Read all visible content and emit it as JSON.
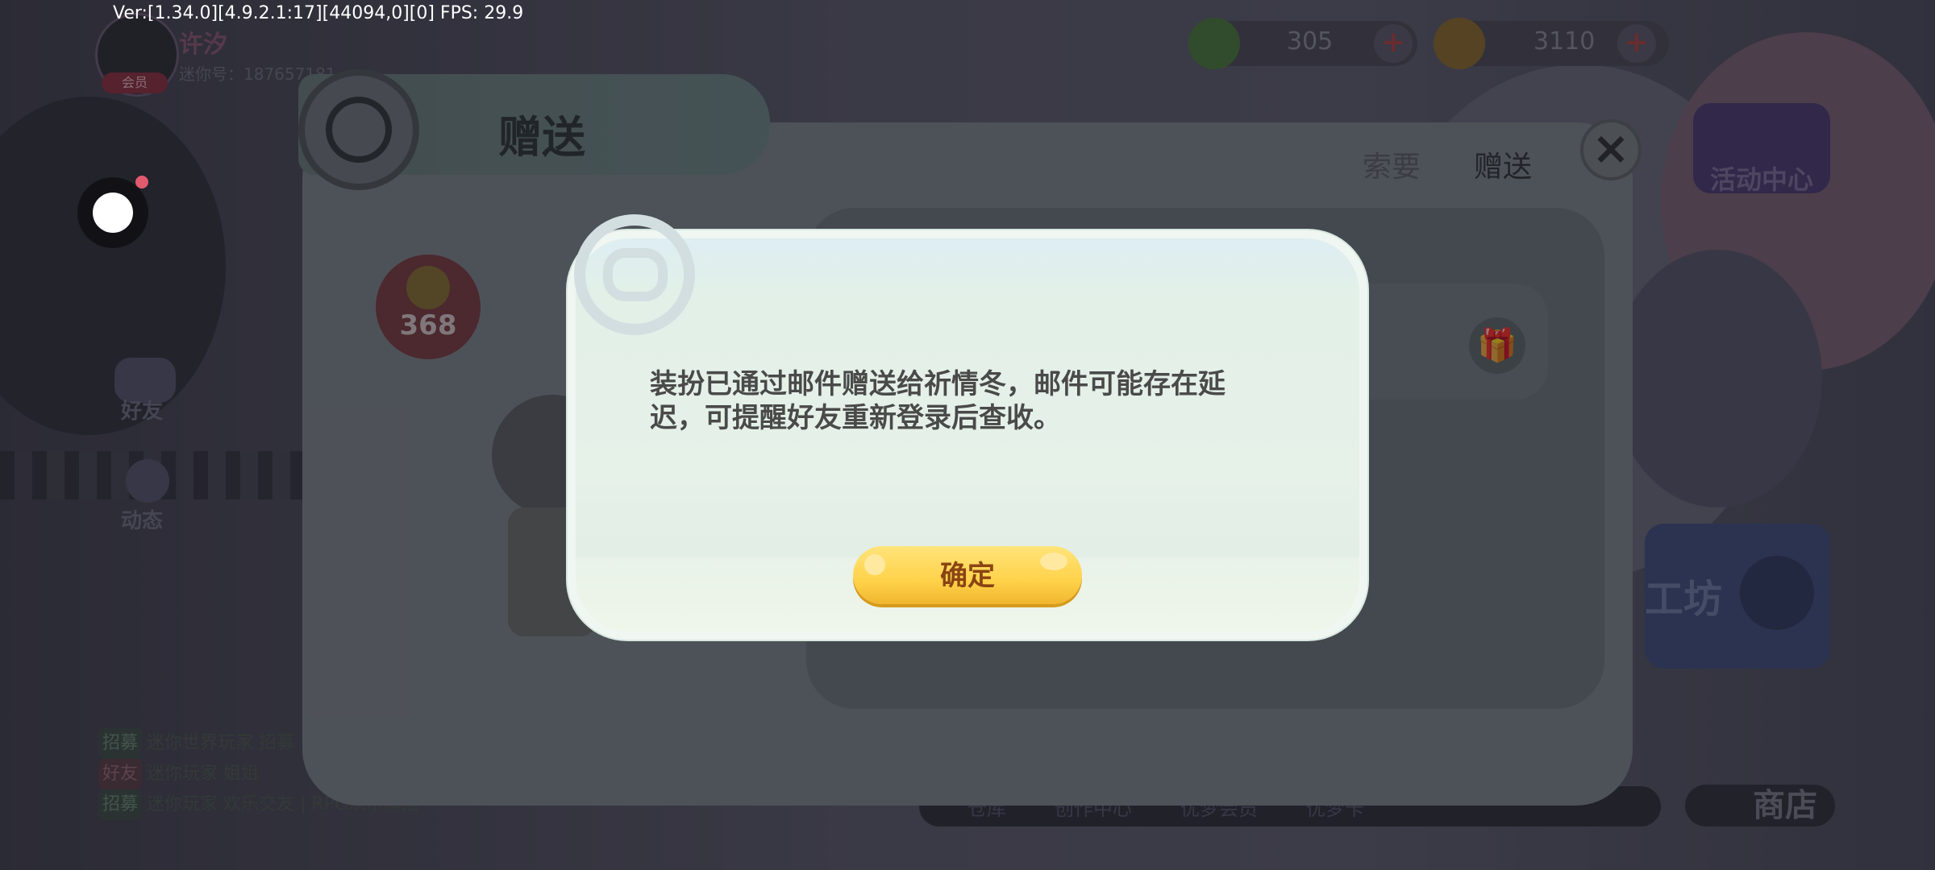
{
  "debug": {
    "fps_text": "Ver:[1.34.0][4.9.2.1:17][44094,0][0] FPS: 29.9"
  },
  "user": {
    "name": "许汐",
    "id_label": "迷你号：187657181",
    "badge": "会员"
  },
  "currency": [
    {
      "name": "green-coin",
      "value": "305",
      "color": "#4a8a3a"
    },
    {
      "name": "gold-coin",
      "value": "3110",
      "color": "#8a7a2a"
    }
  ],
  "side_nav": {
    "friends": "好友",
    "feed": "动态"
  },
  "right_panel": {
    "event_center": "活动中心",
    "workshop": "工坊",
    "shop": "商店"
  },
  "bottom_bar": [
    "仓库",
    "创作中心",
    "优梦会员",
    "优梦卡"
  ],
  "chat": [
    {
      "tag": "招募",
      "text": "迷你世界玩家 招募"
    },
    {
      "tag": "好友",
      "text": "迷你玩家 姐姐"
    },
    {
      "tag": "招募",
      "text": "迷你玩家 欢乐交友 | RPG欢乐掉落"
    }
  ],
  "gift_panel": {
    "title": "赠送",
    "tabs": [
      {
        "label": "索要",
        "active": false
      },
      {
        "label": "赠送",
        "active": true
      }
    ],
    "price": "368"
  },
  "modal": {
    "message": "装扮已通过邮件赠送给祈情冬，邮件可能存在延迟，可提醒好友重新登录后查收。",
    "confirm_label": "确定"
  },
  "colors": {
    "accent_yellow": "#ffd24a",
    "confirm_text": "#8a4412",
    "modal_bg": "#e6f1e8"
  }
}
